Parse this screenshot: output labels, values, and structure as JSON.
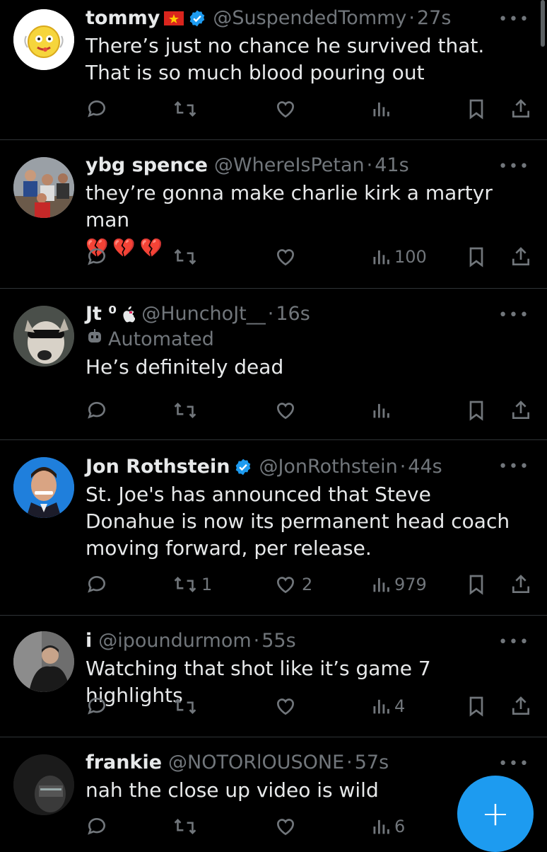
{
  "tweets": [
    {
      "name": "tommy",
      "flag": "vn",
      "verified": true,
      "handle": "@SuspendedTommy",
      "time": "27s",
      "text": "There’s just no chance he survived that. That is so much blood pouring out",
      "emoji": "",
      "automated": "",
      "reply": "",
      "retweet": "",
      "like": "",
      "views": ""
    },
    {
      "name": "ybg spence",
      "flag": "",
      "verified": false,
      "handle": "@WhereIsPetan",
      "time": "41s",
      "text": "they’re gonna make charlie kirk a martyr man",
      "emoji": "💔💔💔",
      "automated": "",
      "reply": "",
      "retweet": "",
      "like": "",
      "views": "100"
    },
    {
      "name": "Jt ⁰",
      "flag": "",
      "verified": false,
      "handle": "@HunchoJt__",
      "time": "16s",
      "text": "He’s definitely dead",
      "emoji": "",
      "automated": "Automated",
      "reply": "",
      "retweet": "",
      "like": "",
      "views": ""
    },
    {
      "name": "Jon Rothstein",
      "flag": "",
      "verified": true,
      "handle": "@JonRothstein",
      "time": "44s",
      "text": "St. Joe's has announced that Steve Donahue is now its permanent head coach moving forward, per release.",
      "emoji": "",
      "automated": "",
      "reply": "",
      "retweet": "1",
      "like": "2",
      "views": "979"
    },
    {
      "name": "i",
      "flag": "",
      "verified": false,
      "handle": "@ipoundurmom",
      "time": "55s",
      "text": "Watching that shot like it’s game 7 highlights",
      "emoji": "",
      "automated": "",
      "reply": "",
      "retweet": "",
      "like": "",
      "views": "4"
    },
    {
      "name": "frankie",
      "flag": "",
      "verified": false,
      "handle": "@NOTORlOUSONE",
      "time": "57s",
      "text": "nah the close up video is wild",
      "emoji": "",
      "automated": "",
      "reply": "",
      "retweet": "",
      "like": "",
      "views": "6"
    }
  ],
  "ui": {
    "separator": "·",
    "more": "•••",
    "compose_label": "+",
    "accent": "#1d9bf0",
    "muted": "#71767b",
    "background": "#000000"
  }
}
